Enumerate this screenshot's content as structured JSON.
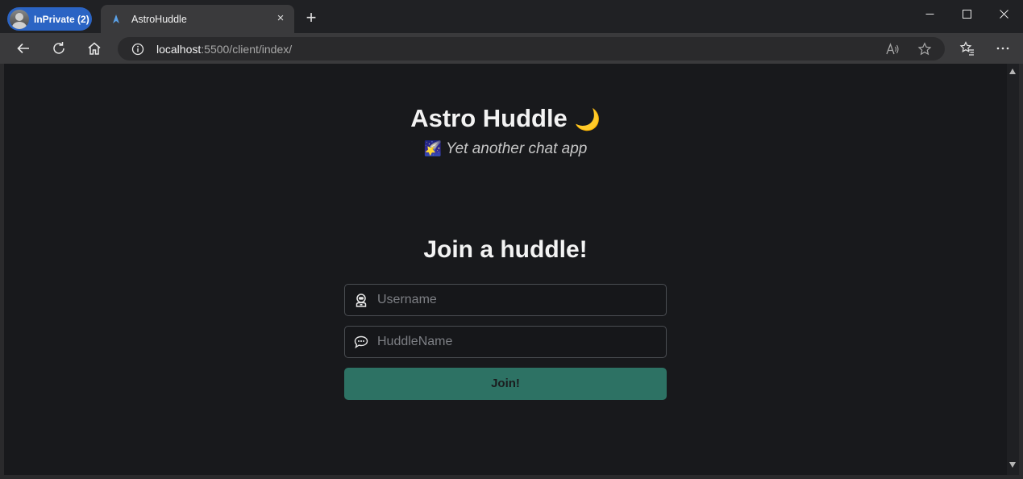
{
  "browser": {
    "profile_label": "InPrivate (2)",
    "tab_title": "AstroHuddle",
    "tab_close": "×",
    "new_tab": "+",
    "url_host": "localhost",
    "url_rest": ":5500/client/index/"
  },
  "page": {
    "title": "Astro Huddle",
    "title_emoji": "🌙",
    "subtitle_emoji": "🌠",
    "subtitle": "Yet another chat app",
    "join_heading": "Join a huddle!",
    "username_placeholder": "Username",
    "huddle_placeholder": "HuddleName",
    "join_label": "Join!"
  },
  "colors": {
    "page_bg": "#18191c",
    "accent_button": "#2d7264",
    "inprivate_badge": "#2b64c4"
  },
  "icons": {
    "username_field": "astronaut-icon",
    "huddle_field": "chat-bubble-icon"
  }
}
